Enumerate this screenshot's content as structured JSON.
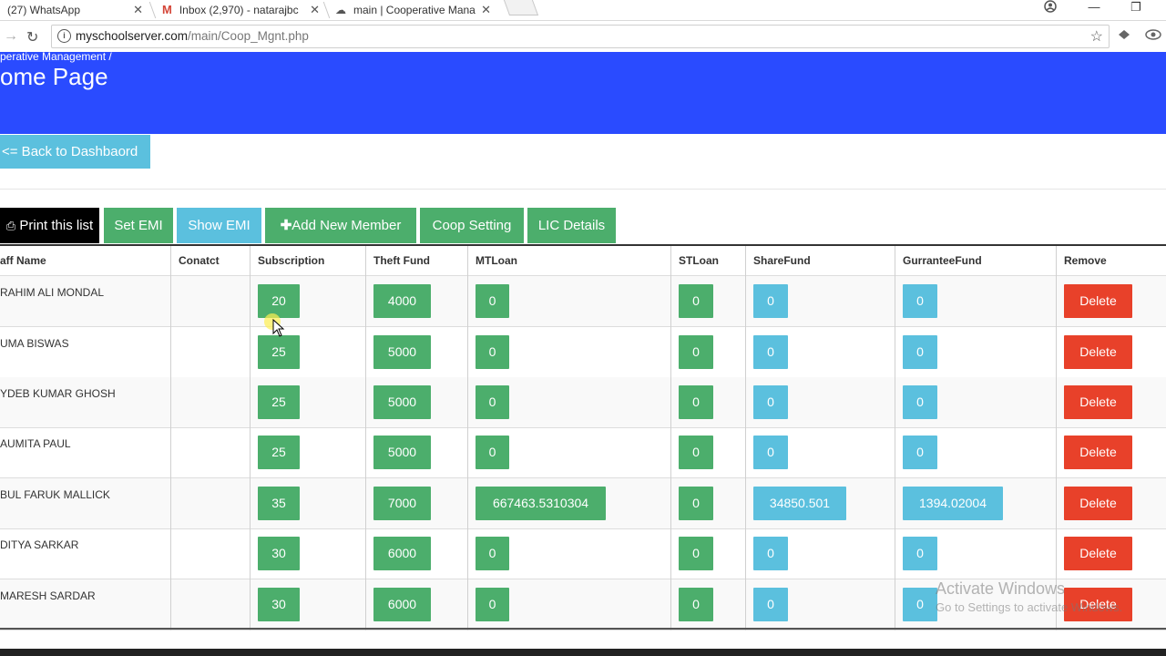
{
  "browser": {
    "tabs": [
      {
        "label": "(27) WhatsApp"
      },
      {
        "label": "Inbox (2,970) - natarajbc"
      },
      {
        "label": "main | Cooperative Mana"
      }
    ],
    "url_host": "myschoolserver.com",
    "url_path": "/main/Coop_Mgnt.php"
  },
  "header": {
    "breadcrumb": "perative Management /",
    "title": "ome Page"
  },
  "back_button": "<= Back to Dashbaord",
  "toolbar": {
    "print": "Print this list",
    "set_emi": "Set EMI",
    "show_emi": "Show EMI",
    "add_member": "Add New Member",
    "coop_setting": "Coop Setting",
    "lic_details": "LIC Details"
  },
  "table": {
    "headers": [
      "aff Name",
      "Conatct",
      "Subscription",
      "Theft Fund",
      "MTLoan",
      "STLoan",
      "ShareFund",
      "GurranteeFund",
      "Remove"
    ],
    "rows": [
      {
        "name": "RAHIM ALI MONDAL",
        "subscription": "20",
        "theft": "4000",
        "mtloan": "0",
        "stloan": "0",
        "share": "0",
        "guarantee": "0",
        "remove": "Delete"
      },
      {
        "name": "UMA BISWAS",
        "subscription": "25",
        "theft": "5000",
        "mtloan": "0",
        "stloan": "0",
        "share": "0",
        "guarantee": "0",
        "remove": "Delete"
      },
      {
        "name": "YDEB KUMAR GHOSH",
        "subscription": "25",
        "theft": "5000",
        "mtloan": "0",
        "stloan": "0",
        "share": "0",
        "guarantee": "0",
        "remove": "Delete"
      },
      {
        "name": "AUMITA PAUL",
        "subscription": "25",
        "theft": "5000",
        "mtloan": "0",
        "stloan": "0",
        "share": "0",
        "guarantee": "0",
        "remove": "Delete"
      },
      {
        "name": "BUL FARUK MALLICK",
        "subscription": "35",
        "theft": "7000",
        "mtloan": "667463.5310304",
        "stloan": "0",
        "share": "34850.501",
        "guarantee": "1394.02004",
        "remove": "Delete"
      },
      {
        "name": "DITYA SARKAR",
        "subscription": "30",
        "theft": "6000",
        "mtloan": "0",
        "stloan": "0",
        "share": "0",
        "guarantee": "0",
        "remove": "Delete"
      },
      {
        "name": "MARESH SARDAR",
        "subscription": "30",
        "theft": "6000",
        "mtloan": "0",
        "stloan": "0",
        "share": "0",
        "guarantee": "0",
        "remove": "Delete"
      }
    ]
  },
  "watermark": {
    "line1": "Activate Windows",
    "line2": "Go to Settings to activate Windows."
  },
  "colors": {
    "banner": "#2a4bff",
    "green": "#4cae6c",
    "blue": "#5bc0de",
    "red": "#e8412a"
  }
}
